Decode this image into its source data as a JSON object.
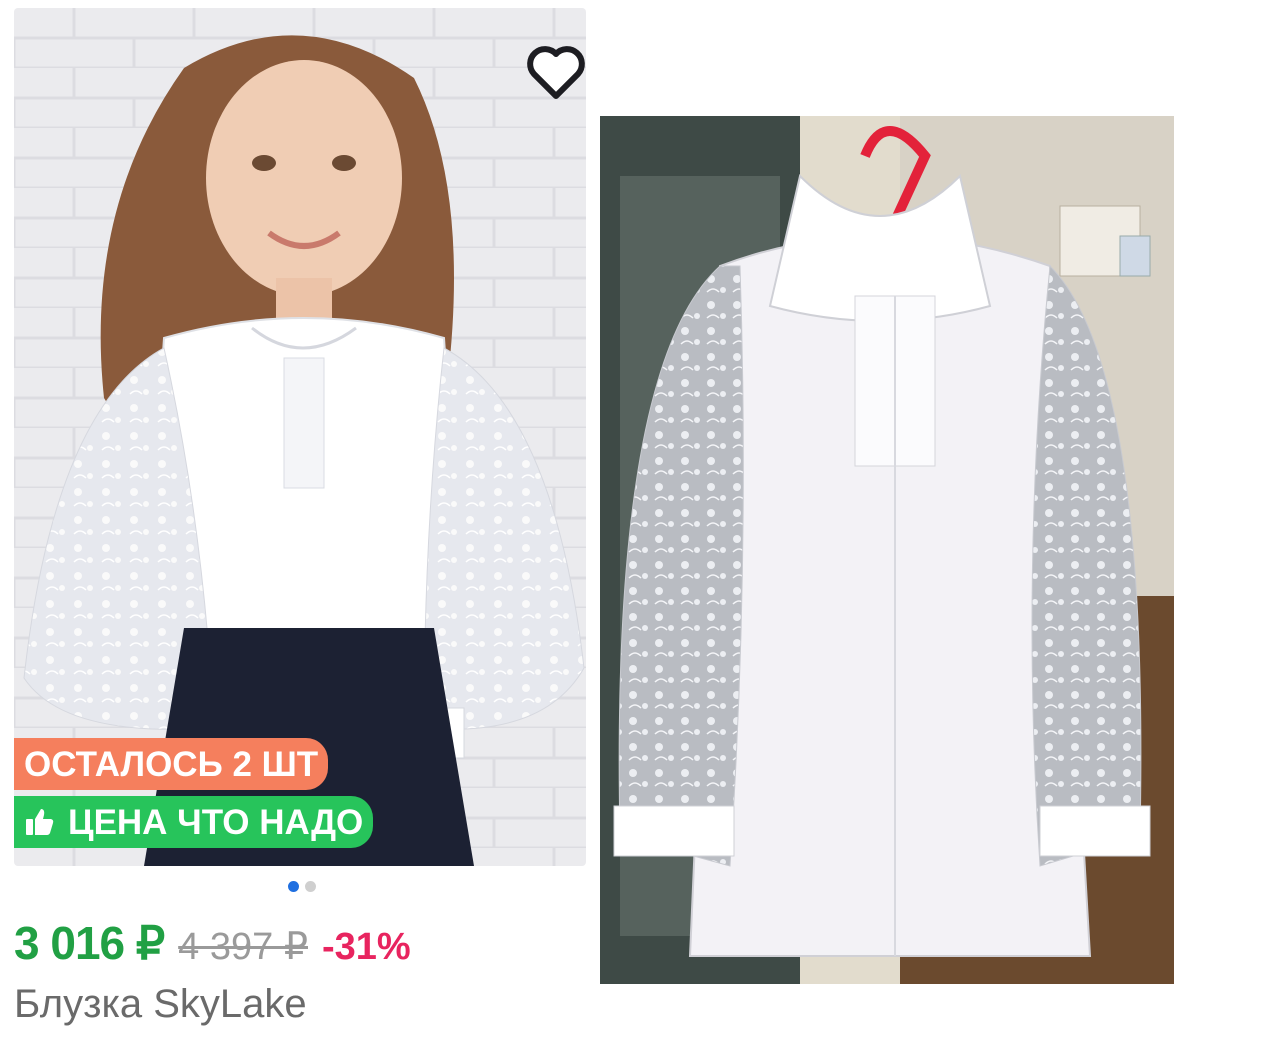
{
  "product": {
    "badge_stock": "ОСТАЛОСЬ 2 ШТ",
    "badge_price": "ЦЕНА ЧТО НАДО",
    "price_current": "3 016 ₽",
    "price_old": "4 397 ₽",
    "discount": "-31%",
    "title": "Блузка SkyLake",
    "carousel": {
      "total": 2,
      "active": 1
    },
    "colors": {
      "price_green": "#21a044",
      "discount_pink": "#e8245f",
      "badge_orange": "#f57f5d",
      "badge_green": "#27c45b",
      "dot_active": "#1f6fe0",
      "dot_inactive": "#cfcfcf"
    }
  },
  "icons": {
    "favorite": "heart-outline-icon",
    "thumbs_up": "thumbs-up-icon"
  }
}
